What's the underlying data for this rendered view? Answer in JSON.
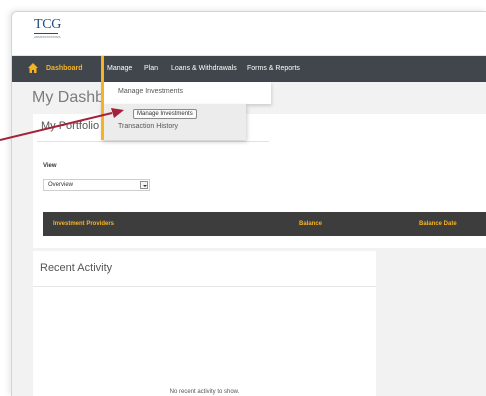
{
  "logo": {
    "text": "TCG",
    "subtext": "ADMINISTRATORS"
  },
  "nav": {
    "items": [
      {
        "id": "dashboard",
        "label": "Dashboard",
        "active": true
      },
      {
        "id": "manage",
        "label": "Manage",
        "active": false
      },
      {
        "id": "plan",
        "label": "Plan",
        "active": false
      },
      {
        "id": "loans",
        "label": "Loans & Withdrawals",
        "active": false
      },
      {
        "id": "forms",
        "label": "Forms & Reports",
        "active": false
      }
    ]
  },
  "dropdown": {
    "items": [
      {
        "label": "Manage Investments"
      },
      {
        "label": "Transaction History"
      }
    ],
    "tooltip": "Manage Investments"
  },
  "page": {
    "title": "My Dashboard"
  },
  "portfolio": {
    "title": "My Portfolio",
    "view_label": "View",
    "view_selected": "Overview",
    "columns": [
      "Investment Providers",
      "Balance",
      "Balance Date"
    ]
  },
  "activity": {
    "title": "Recent Activity",
    "empty_message": "No recent activity to show."
  },
  "colors": {
    "accent": "#f6b321",
    "nav_bg": "#40464c",
    "table_header_bg": "#3d3d3d",
    "brand": "#1f4f7d",
    "annotation_arrow": "#a5213a"
  }
}
